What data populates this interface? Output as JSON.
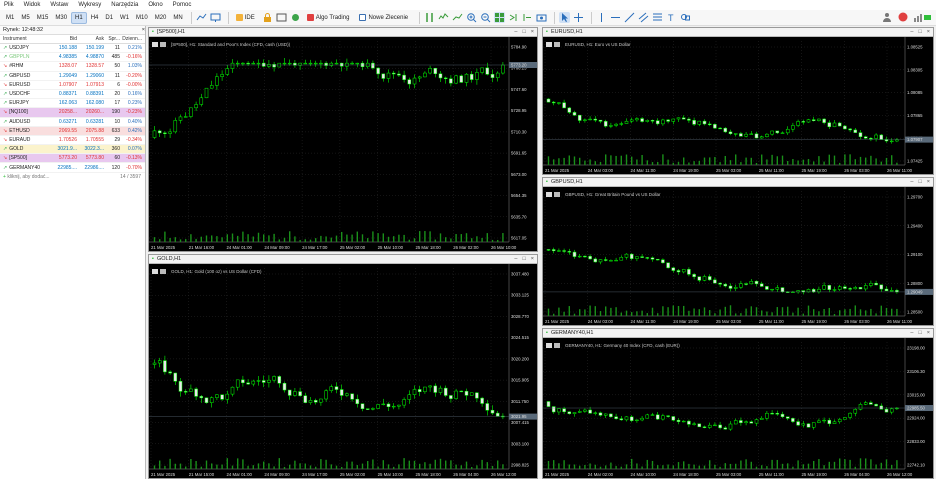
{
  "menu": [
    "Plik",
    "Widok",
    "Wstaw",
    "Wykresy",
    "Narzędzia",
    "Okno",
    "Pomoc"
  ],
  "timeframes": [
    "M1",
    "M5",
    "M15",
    "M30",
    "H1",
    "H4",
    "D1",
    "W1",
    "MN",
    "M10",
    "M20",
    "MN"
  ],
  "toolbar": {
    "ide": "IDE",
    "algo": "Algo Trading",
    "new_order": "Nowe Zlecenie"
  },
  "colors": {
    "bull": "#00ff00",
    "bear": "#00ff00",
    "chart_bg": "#000000",
    "grid": "#2a2a2a",
    "up": "#0070c0",
    "down": "#e03030"
  },
  "market_watch": {
    "title": "Rynek: 12:48:32",
    "headers": {
      "symbol": "Instrument",
      "bid": "Bid",
      "ask": "Ask",
      "spread": "Spr...",
      "change": "Dzienn..."
    },
    "rows": [
      {
        "symbol": "USDJPY",
        "bid": "150.188",
        "ask": "150.199",
        "spread": "11",
        "change": "0.21%",
        "dir": "up",
        "bg": ""
      },
      {
        "symbol": "GBPPLN",
        "bid": "4.98385",
        "ask": "4.98870",
        "spread": "485",
        "change": "-0.16%",
        "dir": "up",
        "bg": "",
        "faded": true
      },
      {
        "symbol": "#RHM",
        "bid": "1328.07",
        "ask": "1328.57",
        "spread": "50",
        "change": "1.03%",
        "dir": "down",
        "bg": ""
      },
      {
        "symbol": "GBPUSD",
        "bid": "1.29049",
        "ask": "1.29060",
        "spread": "11",
        "change": "-0.20%",
        "dir": "up",
        "bg": ""
      },
      {
        "symbol": "EURUSD",
        "bid": "1.07907",
        "ask": "1.07913",
        "spread": "6",
        "change": "-0.00%",
        "dir": "down",
        "bg": ""
      },
      {
        "symbol": "USDCHF",
        "bid": "0.88371",
        "ask": "0.88391",
        "spread": "20",
        "change": "0.16%",
        "dir": "up",
        "bg": ""
      },
      {
        "symbol": "EURJPY",
        "bid": "162.063",
        "ask": "162.080",
        "spread": "17",
        "change": "0.23%",
        "dir": "up",
        "bg": ""
      },
      {
        "symbol": "[NQ100]",
        "bid": "20258...",
        "ask": "20260...",
        "spread": "190",
        "change": "-0.23%",
        "dir": "down",
        "bg": "#e8c8ef"
      },
      {
        "symbol": "AUDUSD",
        "bid": "0.63271",
        "ask": "0.63281",
        "spread": "10",
        "change": "0.40%",
        "dir": "up",
        "bg": ""
      },
      {
        "symbol": "ETHUSD",
        "bid": "2069.55",
        "ask": "2075.88",
        "spread": "633",
        "change": "0.42%",
        "dir": "down",
        "bg": "#f9dede"
      },
      {
        "symbol": "EURAUD",
        "bid": "1.70526",
        "ask": "1.70555",
        "spread": "29",
        "change": "-0.34%",
        "dir": "down",
        "bg": ""
      },
      {
        "symbol": "GOLD",
        "bid": "3021.9...",
        "ask": "3022.3...",
        "spread": "360",
        "change": "0.07%",
        "dir": "up",
        "bg": "#fbf3cc"
      },
      {
        "symbol": "[SP500]",
        "bid": "5773.20",
        "ask": "5773.80",
        "spread": "60",
        "change": "-0.13%",
        "dir": "down",
        "bg": "#e8c8ef"
      },
      {
        "symbol": "GERMANY40",
        "bid": "22985....",
        "ask": "22986....",
        "spread": "120",
        "change": "-0.70%",
        "dir": "up",
        "bg": ""
      }
    ],
    "add_hint": "kliknij, aby dodać...",
    "count": "14 / 3597"
  },
  "charts": [
    {
      "window_title": "[SP500],H1",
      "description": "[SP500], H1: Standard and Poor's Index (CFD, cash (USD))",
      "yticks": [
        "5784.90",
        "5766.25",
        "5747.60",
        "5728.95",
        "5710.30",
        "5691.65",
        "5673.00",
        "5654.35",
        "5635.70",
        "5617.05"
      ],
      "current": "5773.20",
      "xticks": [
        "21 Mar 2025",
        "21 Mar 16:00",
        "24 Mar 01:00",
        "24 Mar 09:00",
        "24 Mar 17:00",
        "25 Mar 02:00",
        "25 Mar 10:00",
        "25 Mar 18:00",
        "26 Mar 02:00",
        "26 Mar 10:00"
      ]
    },
    {
      "window_title": "EURUSD,H1",
      "description": "EURUSD, H1: Euro vs US Dollar",
      "yticks": [
        "1.08525",
        "1.08305",
        "1.08085",
        "1.07865",
        "1.07645",
        "1.07425"
      ],
      "current": "1.07907",
      "xticks": [
        "21 Mar 2025",
        "24 Mar 03:00",
        "24 Mar 11:00",
        "24 Mar 19:00",
        "25 Mar 03:00",
        "25 Mar 11:00",
        "25 Mar 19:00",
        "26 Mar 03:00",
        "26 Mar 11:00"
      ]
    },
    {
      "window_title": "GOLD,H1",
      "description": "GOLD, H1: Gold (100 oz) vs US Dollar (CFD)",
      "yticks": [
        "3037.480",
        "3033.125",
        "3028.770",
        "3024.515",
        "3020.200",
        "3015.905",
        "3011.750",
        "3007.415",
        "3003.100",
        "2998.825"
      ],
      "current": "3021.95",
      "xticks": [
        "21 Mar 2025",
        "21 Mar 15:00",
        "24 Mar 01:00",
        "24 Mar 09:00",
        "24 Mar 17:00",
        "25 Mar 02:00",
        "25 Mar 10:00",
        "25 Mar 18:00",
        "26 Mar 04:00",
        "26 Mar 12:00"
      ]
    },
    {
      "window_title": "GBPUSD,H1",
      "description": "GBPUSD, H1: Great Britain Pound vs US Dollar",
      "yticks": [
        "1.29700",
        "1.29400",
        "1.29100",
        "1.28800",
        "1.28500"
      ],
      "current": "1.29049",
      "xticks": [
        "21 Mar 2025",
        "24 Mar 03:00",
        "24 Mar 11:00",
        "24 Mar 19:00",
        "25 Mar 03:00",
        "25 Mar 11:00",
        "25 Mar 19:00",
        "26 Mar 03:00",
        "26 Mar 11:00"
      ]
    },
    {
      "window_title": "GERMANY40,H1",
      "description": "GERMANY40, H1: Germany 40 Index (CFD, cash (EUR))",
      "yticks": [
        "23198.00",
        "23106.30",
        "23015.00",
        "22924.00",
        "22833.00",
        "22742.10"
      ],
      "current": "22985.50",
      "xticks": [
        "21 Mar 2025",
        "24 Mar 02:00",
        "24 Mar 10:00",
        "24 Mar 18:00",
        "25 Mar 03:00",
        "25 Mar 11:00",
        "25 Mar 19:00",
        "26 Mar 04:00",
        "26 Mar 12:00"
      ]
    }
  ]
}
